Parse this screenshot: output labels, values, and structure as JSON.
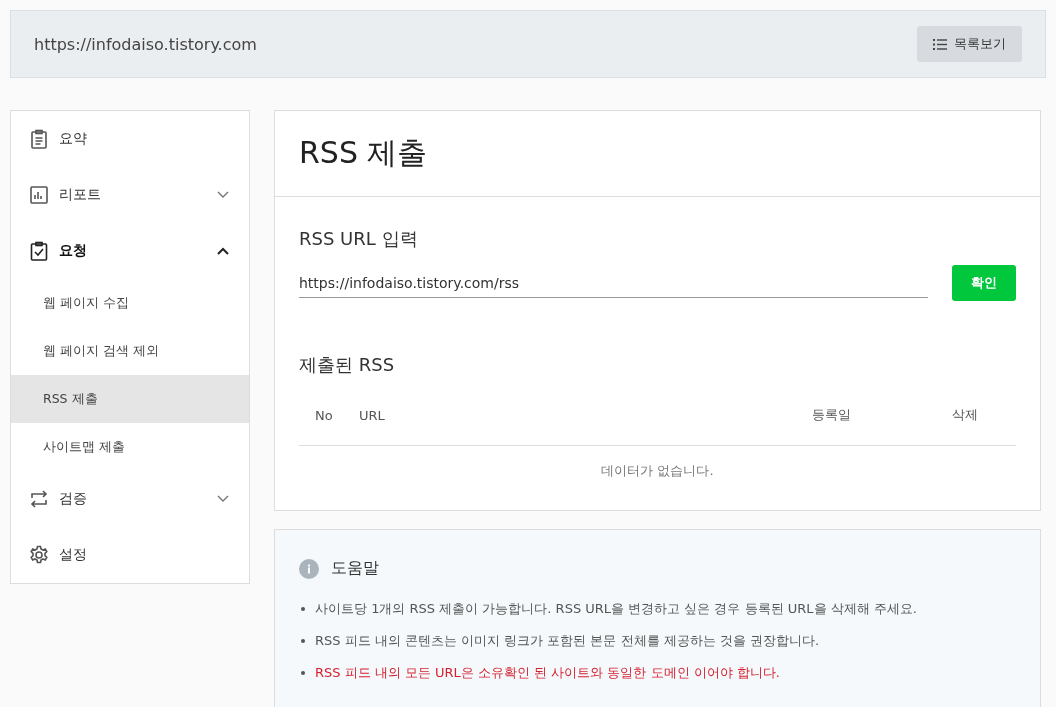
{
  "header": {
    "url": "https://infodaiso.tistory.com",
    "list_button": "목록보기"
  },
  "sidebar": {
    "items": [
      {
        "label": "요약",
        "kind": "link",
        "selected": false
      },
      {
        "label": "리포트",
        "kind": "group",
        "selected": false,
        "expanded": false
      },
      {
        "label": "요청",
        "kind": "group",
        "selected": true,
        "expanded": true,
        "children": [
          {
            "label": "웹 페이지 수집",
            "selected": false
          },
          {
            "label": "웹 페이지 검색 제외",
            "selected": false
          },
          {
            "label": "RSS 제출",
            "selected": true
          },
          {
            "label": "사이트맵 제출",
            "selected": false
          }
        ]
      },
      {
        "label": "검증",
        "kind": "group",
        "selected": false,
        "expanded": false
      },
      {
        "label": "설정",
        "kind": "link",
        "selected": false
      }
    ]
  },
  "main": {
    "title": "RSS 제출",
    "url_section": {
      "label": "RSS URL 입력",
      "value": "https://infodaiso.tistory.com/rss",
      "confirm_button": "확인"
    },
    "submitted": {
      "title": "제출된 RSS",
      "columns": [
        "No",
        "URL",
        "등록일",
        "삭제"
      ],
      "empty_message": "데이터가 없습니다."
    }
  },
  "help": {
    "title": "도움말",
    "items": [
      {
        "text": "사이트당 1개의 RSS 제출이 가능합니다. RSS URL을 변경하고 싶은 경우 등록된 URL을 삭제해 주세요.",
        "kind": "note"
      },
      {
        "text": "RSS 피드 내의 콘텐츠는 이미지 링크가 포함된 본문 전체를 제공하는 것을 권장합니다.",
        "kind": "note"
      },
      {
        "text": "RSS 피드 내의 모든 URL은 소유확인 된 사이트와 동일한 도메인 이어야 합니다.",
        "kind": "warning"
      }
    ]
  }
}
